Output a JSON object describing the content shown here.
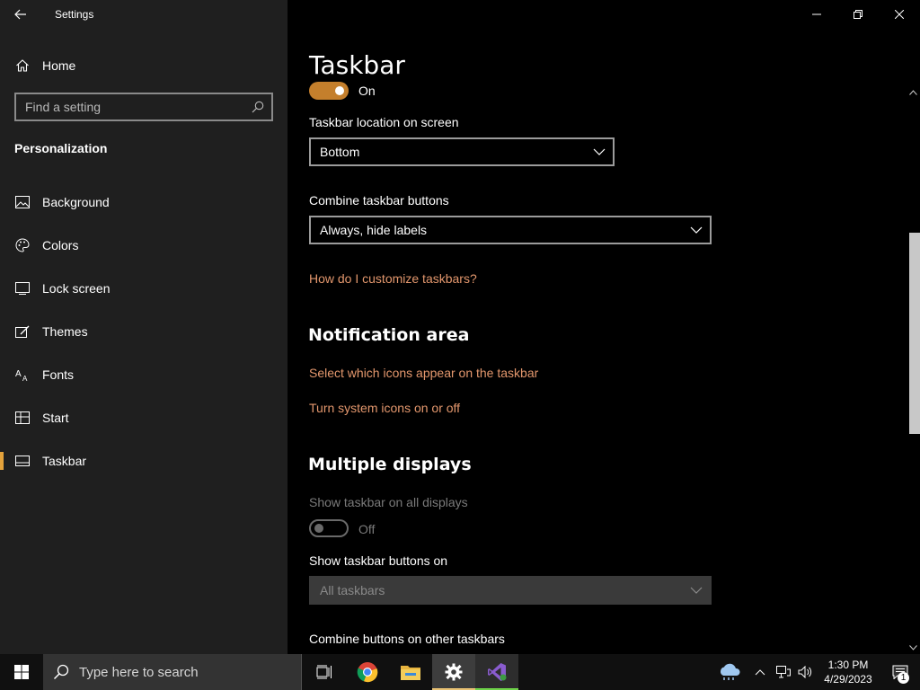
{
  "window": {
    "app_title": "Settings",
    "controls": {
      "minimize": "minimize",
      "restore": "restore",
      "close": "close"
    }
  },
  "sidebar": {
    "home_label": "Home",
    "search_placeholder": "Find a setting",
    "section_heading": "Personalization",
    "items": [
      {
        "label": "Background",
        "icon": "image-icon"
      },
      {
        "label": "Colors",
        "icon": "palette-icon"
      },
      {
        "label": "Lock screen",
        "icon": "lock-screen-icon"
      },
      {
        "label": "Themes",
        "icon": "brush-icon"
      },
      {
        "label": "Fonts",
        "icon": "font-icon"
      },
      {
        "label": "Start",
        "icon": "start-icon"
      },
      {
        "label": "Taskbar",
        "icon": "taskbar-icon",
        "active": true
      }
    ],
    "accent_color": "#e3a23b"
  },
  "main": {
    "page_title": "Taskbar",
    "top_toggle": {
      "state": "On"
    },
    "location_label": "Taskbar location on screen",
    "location_value": "Bottom",
    "combine_label": "Combine taskbar buttons",
    "combine_value": "Always, hide labels",
    "customize_link": "How do I customize taskbars?",
    "notification_heading": "Notification area",
    "notif_link_1": "Select which icons appear on the taskbar",
    "notif_link_2": "Turn system icons on or off",
    "multi_heading": "Multiple displays",
    "show_all_label": "Show taskbar on all displays",
    "show_all_state": "Off",
    "buttons_on_label": "Show taskbar buttons on",
    "buttons_on_value": "All taskbars",
    "combine_other_label": "Combine buttons on other taskbars",
    "link_color": "#e3976d"
  },
  "taskbar": {
    "search_placeholder": "Type here to search",
    "apps": [
      "task-view-icon",
      "chrome-icon",
      "file-explorer-icon",
      "settings-icon",
      "visual-studio-icon"
    ],
    "clock_time": "1:30 PM",
    "clock_date": "4/29/2023",
    "notification_count": "1"
  }
}
